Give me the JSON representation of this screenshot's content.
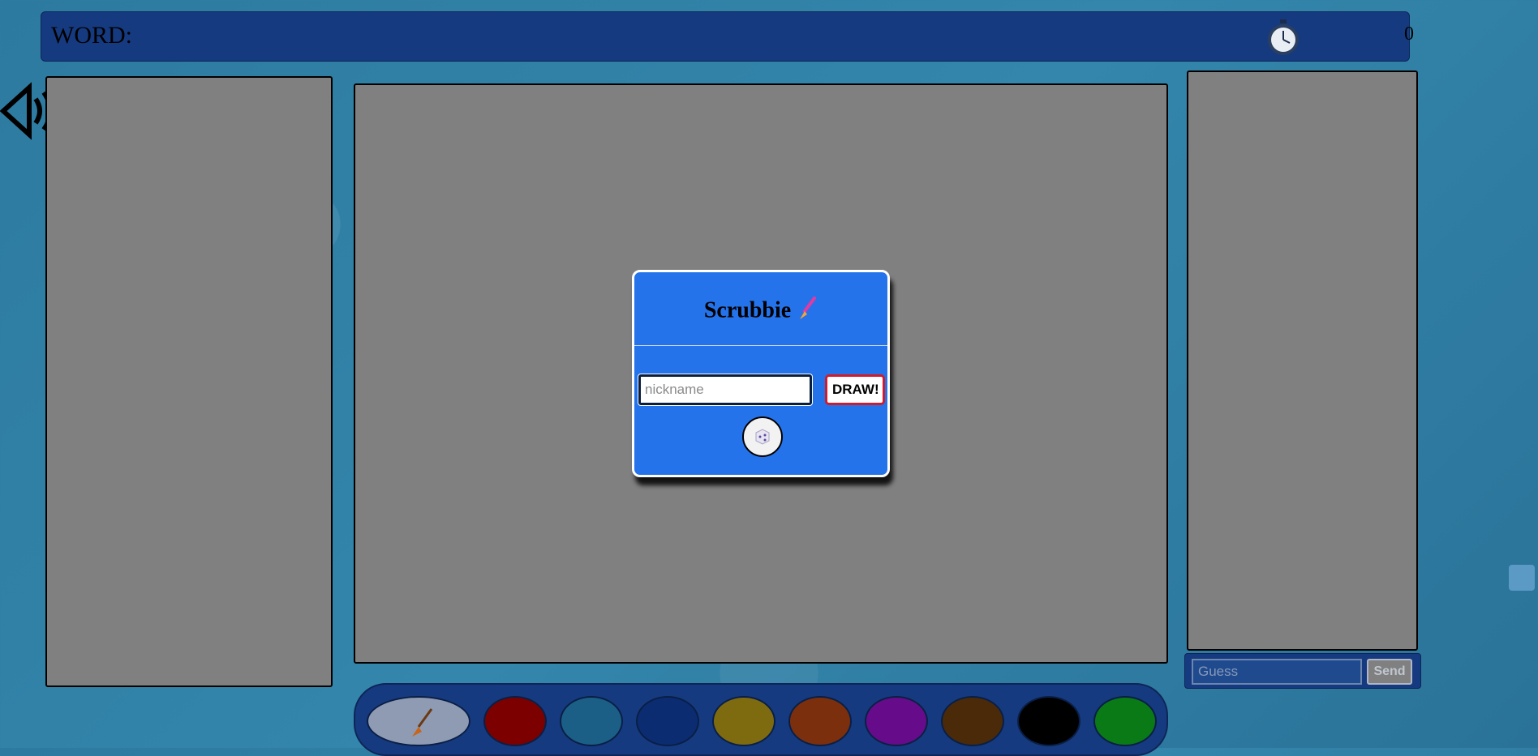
{
  "header": {
    "word_label": "WORD:",
    "score": "0",
    "timer_icon": "stopwatch-icon"
  },
  "sound": {
    "icon": "speaker-icon"
  },
  "modal": {
    "title": "Scrubbie",
    "title_icon": "paintbrush-icon",
    "nickname_placeholder": "nickname",
    "nickname_value": "",
    "draw_label": "DRAW!",
    "random_icon": "dice-icon"
  },
  "chat": {
    "guess_placeholder": "Guess",
    "send_label": "Send"
  },
  "palette": {
    "brush_icon": "brush-icon",
    "colors": [
      "#7c0000",
      "#1b5f86",
      "#0c2c72",
      "#7f6b0f",
      "#7b2f0c",
      "#660c8a",
      "#4a2a08",
      "#000000",
      "#0a7a16"
    ]
  },
  "colors": {
    "background": "#2f7ea3",
    "bar": "#163a7f",
    "panel": "#808080",
    "modal": "#2573eb",
    "draw_border": "#d21b2a"
  }
}
